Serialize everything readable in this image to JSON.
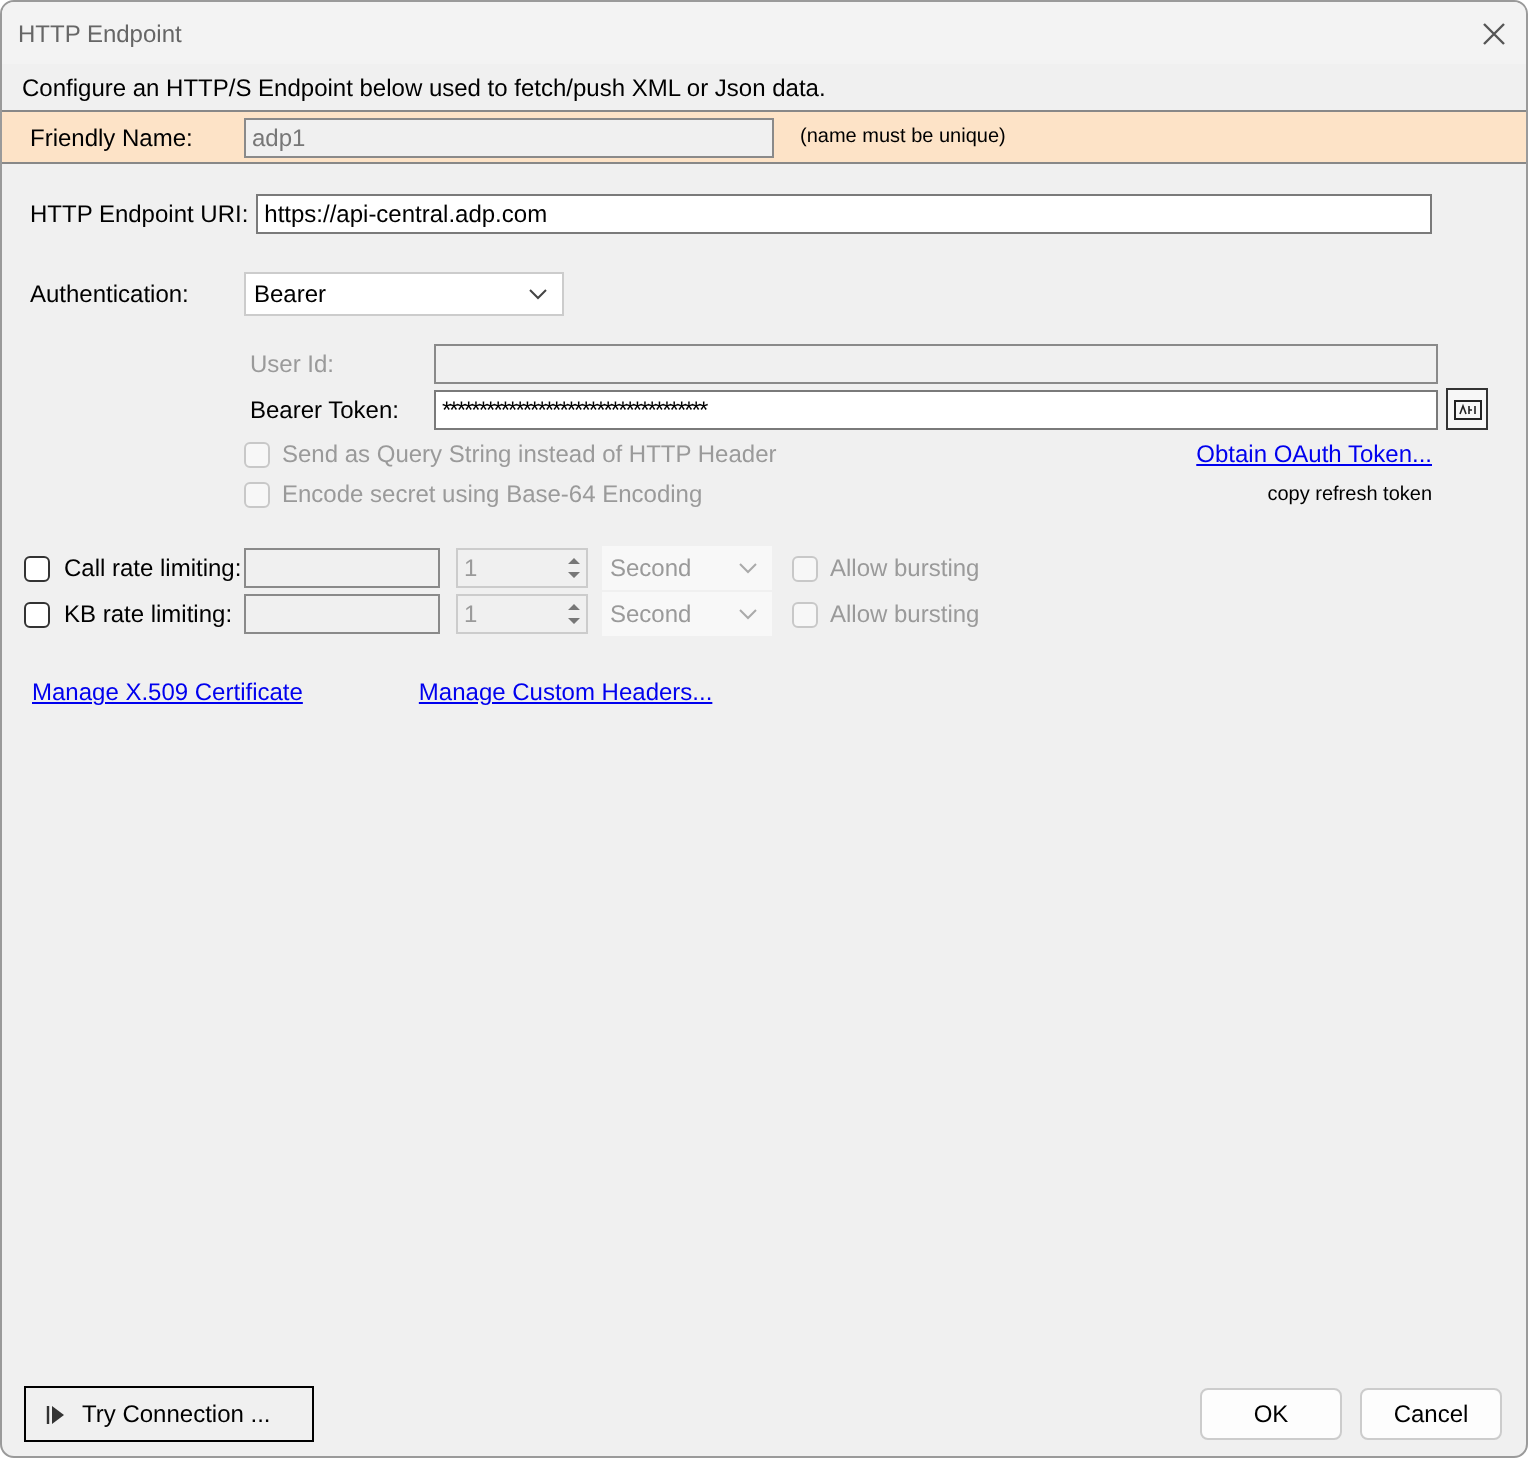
{
  "window": {
    "title": "HTTP Endpoint"
  },
  "description": "Configure an HTTP/S Endpoint below used to fetch/push XML or Json data.",
  "friendly_name": {
    "label": "Friendly Name:",
    "value": "adp1",
    "disabled": true,
    "note": "(name must be unique)"
  },
  "uri": {
    "label": "HTTP Endpoint URI:",
    "value": "https://api-central.adp.com"
  },
  "authentication": {
    "label": "Authentication:",
    "value": "Bearer"
  },
  "user_id": {
    "label": "User Id:",
    "disabled": true
  },
  "bearer_token": {
    "label": "Bearer Token:",
    "value": "************************************",
    "disabled": false
  },
  "options": [
    {
      "label": "Send as Query String instead of HTTP Header",
      "checked": false,
      "disabled": true,
      "link": "Obtain OAuth Token..."
    },
    {
      "label": "Encode secret using Base-64 Encoding",
      "checked": false,
      "disabled": true,
      "note": "copy refresh token"
    }
  ],
  "rate_limits": [
    {
      "label": "Call rate limiting:",
      "checked": false,
      "count": "1",
      "unit": "Second",
      "bursting": {
        "label": "Allow bursting",
        "checked": false
      }
    },
    {
      "label": "KB rate limiting:",
      "checked": false,
      "count": "1",
      "unit": "Second",
      "bursting": {
        "label": "Allow bursting",
        "checked": false
      }
    }
  ],
  "links": [
    "Manage X.509 Certificate",
    "Manage Custom Headers..."
  ],
  "try_connection": "Try Connection ...",
  "buttons": [
    "OK",
    "Cancel"
  ]
}
